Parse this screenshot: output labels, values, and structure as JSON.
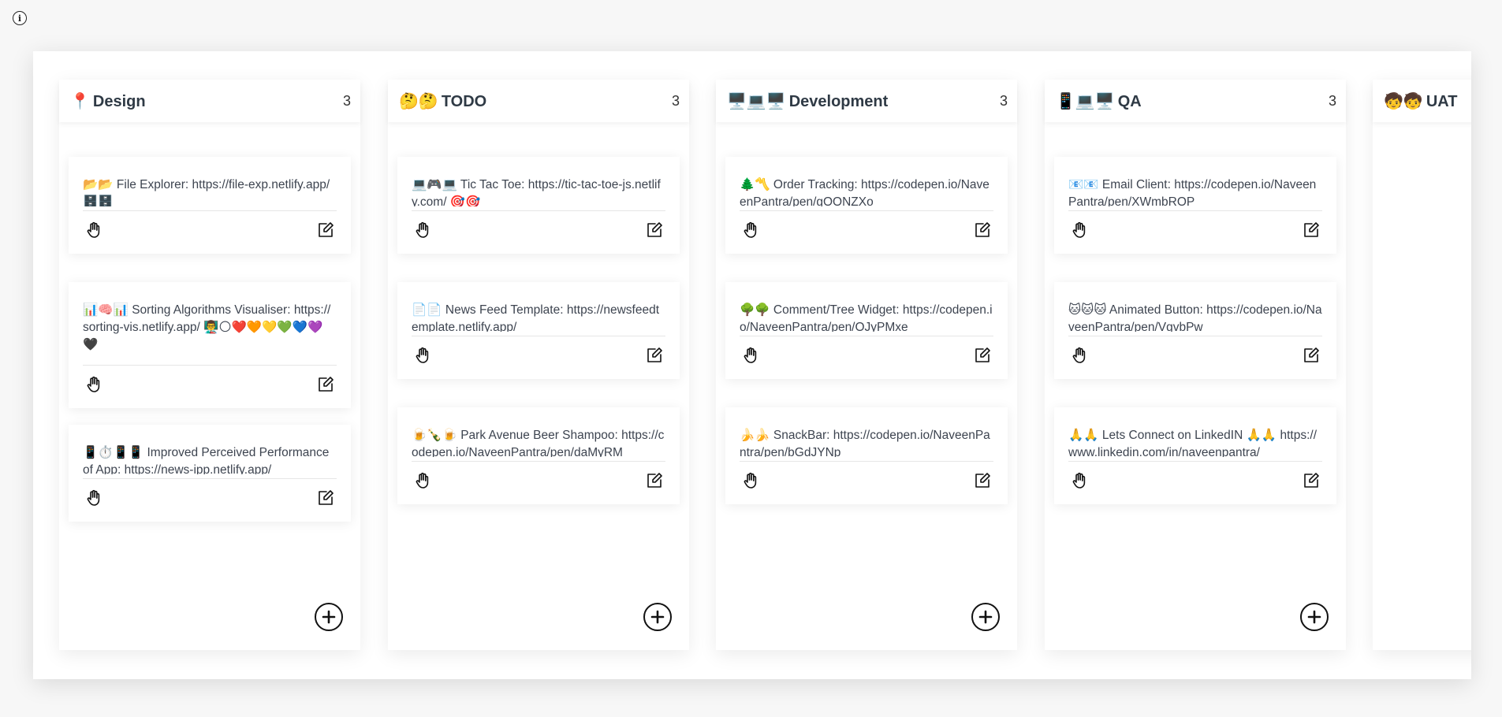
{
  "columns": [
    {
      "title": "Design",
      "emoji": "📍",
      "count": "3",
      "cards": [
        {
          "text": "📂📂 File Explorer: https://file-exp.netlify.app/ 🗄️🗄️"
        },
        {
          "text": "📊🧠📊 Sorting Algorithms Visualiser: https://sorting-vis.netlify.app/ 👨‍🏫🌕❤️🧡💛💚💙💜🖤"
        },
        {
          "text": "📱⏱️📱📱 Improved Perceived Performance of App: https://news-ipp.netlify.app/"
        }
      ]
    },
    {
      "title": "TODO",
      "emoji": "🤔🤔",
      "count": "3",
      "cards": [
        {
          "text": "💻🎮💻 Tic Tac Toe: https://tic-tac-toe-js.netlify.com/ 🎯🎯"
        },
        {
          "text": "📄📄 News Feed Template: https://newsfeedtemplate.netlify.app/"
        },
        {
          "text": "🍺🍾🍺 Park Avenue Beer Shampoo: https://codepen.io/NaveenPantra/pen/daMyRM"
        }
      ]
    },
    {
      "title": "Development",
      "emoji": "🖥️💻🖥️",
      "count": "3",
      "cards": [
        {
          "text": "🌲〽️ Order Tracking: https://codepen.io/NaveenPantra/pen/gOONZXo"
        },
        {
          "text": "🌳🌳 Comment/Tree Widget: https://codepen.io/NaveenPantra/pen/OJyPMxe"
        },
        {
          "text": "🍌🍌 SnackBar: https://codepen.io/NaveenPantra/pen/bGdJYNp"
        }
      ]
    },
    {
      "title": "QA",
      "emoji": "📱💻🖥️",
      "count": "3",
      "cards": [
        {
          "text": "📧📧 Email Client: https://codepen.io/NaveenPantra/pen/XWmbROP"
        },
        {
          "text": "🐱🐱🐱 Animated Button: https://codepen.io/NaveenPantra/pen/VgvbPw"
        },
        {
          "text": "🙏🙏 Lets Connect on LinkedIN 🙏🙏 https://www.linkedin.com/in/naveenpantra/"
        }
      ]
    },
    {
      "title": "UAT",
      "emoji": "🧒🧒",
      "count": "",
      "cards": []
    }
  ]
}
